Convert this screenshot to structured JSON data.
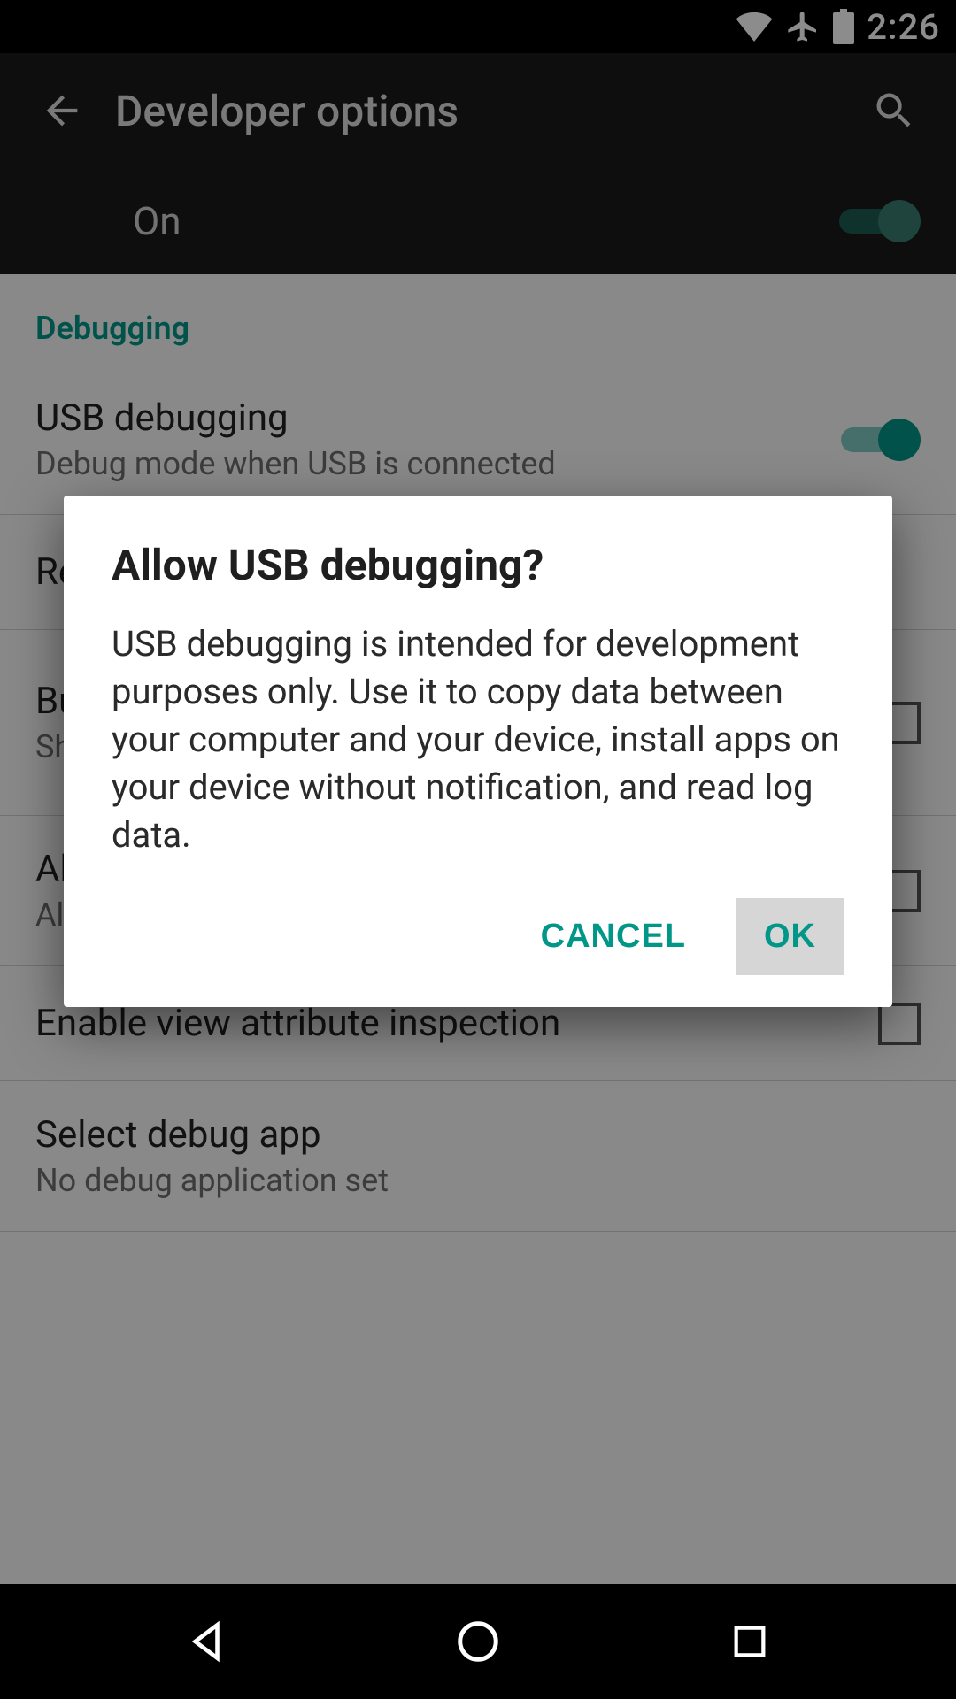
{
  "statusbar": {
    "time": "2:26"
  },
  "appbar": {
    "title": "Developer options"
  },
  "master": {
    "label": "On",
    "on": true
  },
  "section": {
    "label": "Debugging"
  },
  "rows": {
    "usb_debugging": {
      "title": "USB debugging",
      "subtitle": "Debug mode when USB is connected"
    },
    "revoke": {
      "title": "Revoke USB debugging authorizations"
    },
    "bugreport": {
      "title": "Bug report shortcut",
      "subtitle": "Show a button in the power menu for taking a bug report"
    },
    "mock": {
      "title": "Allow mock locations",
      "subtitle": "Allow mock locations"
    },
    "view_attr": {
      "title": "Enable view attribute inspection"
    },
    "debug_app": {
      "title": "Select debug app",
      "subtitle": "No debug application set"
    }
  },
  "dialog": {
    "title": "Allow USB debugging?",
    "body": "USB debugging is intended for development purposes only. Use it to copy data between your computer and your device, install apps on your device without notification, and read log data.",
    "cancel": "Cancel",
    "ok": "OK"
  },
  "colors": {
    "accent": "#009688"
  }
}
